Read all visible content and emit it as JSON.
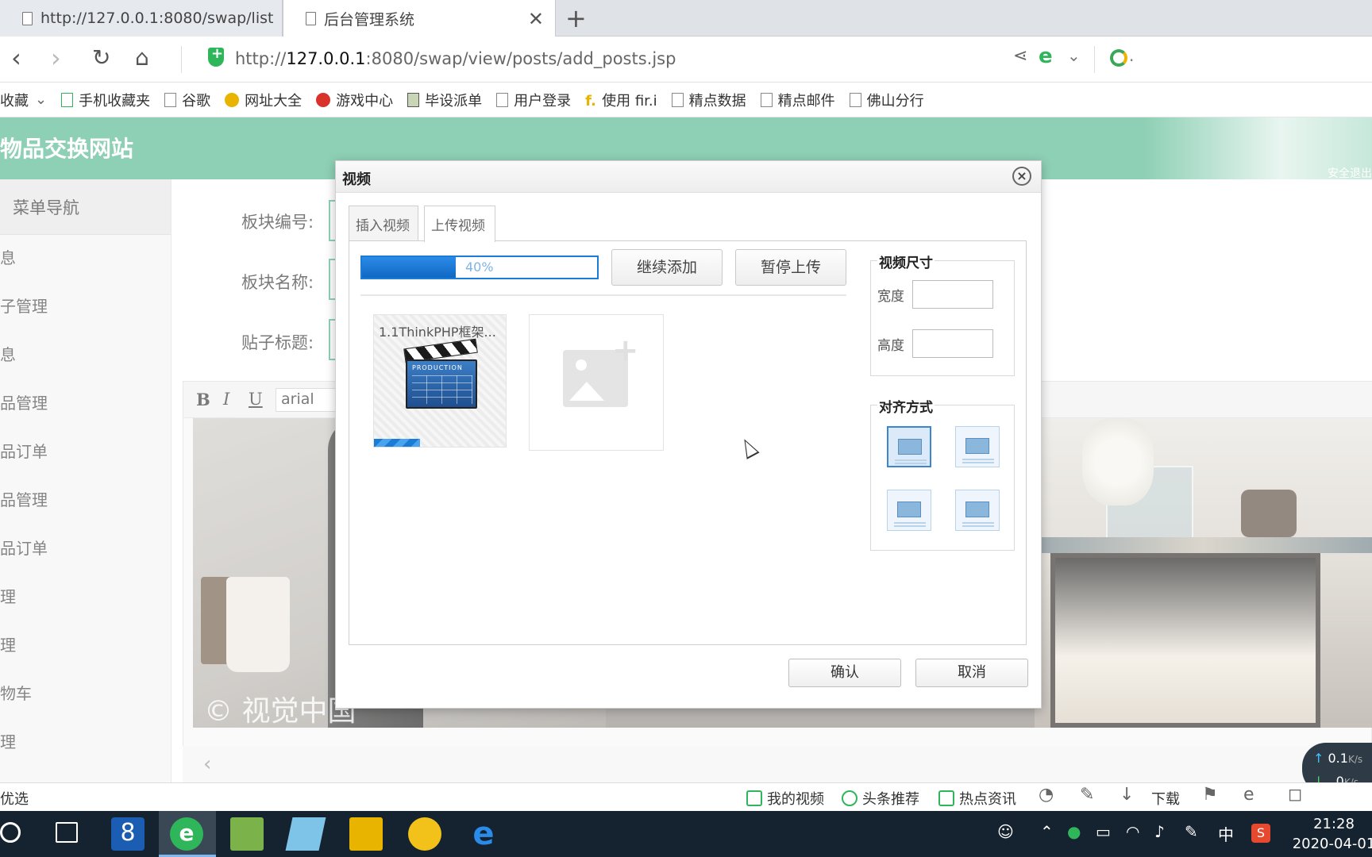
{
  "browser": {
    "tabs": [
      {
        "label": "http://127.0.0.1:8080/swap/list"
      },
      {
        "label": "后台管理系统"
      }
    ],
    "url_prefix": "http://",
    "url_host": "127.0.0.1",
    "url_rest": ":8080/swap/view/posts/add_posts.jsp",
    "bookmarks": [
      {
        "label": "收藏"
      },
      {
        "label": "手机收藏夹"
      },
      {
        "label": "谷歌"
      },
      {
        "label": "网址大全"
      },
      {
        "label": "游戏中心"
      },
      {
        "label": "毕设派单"
      },
      {
        "label": "用户登录"
      },
      {
        "label": "使用 fir.i"
      },
      {
        "label": "精点数据"
      },
      {
        "label": "精点邮件"
      },
      {
        "label": "佛山分行"
      }
    ]
  },
  "app": {
    "title": "物品交换网站",
    "header_link": "安全退出",
    "sidebar": {
      "heading": "菜单导航",
      "items": [
        "息",
        "子管理",
        "息",
        "品管理",
        "品订单",
        "品管理",
        "品订单",
        "理",
        "理",
        "物车",
        "理"
      ]
    },
    "form": {
      "board_no_label": "板块编号:",
      "board_name_label": "板块名称:",
      "post_title_label": "贴子标题:"
    },
    "editor": {
      "bold": "B",
      "italic": "I",
      "underline": "U",
      "font": "arial",
      "watermark": "© 视觉中国"
    }
  },
  "dialog": {
    "title": "视频",
    "tabs": [
      {
        "label": "插入视频",
        "active": false
      },
      {
        "label": "上传视频",
        "active": true
      }
    ],
    "progress_percent": 40,
    "progress_text": "40%",
    "continue_add_label": "继续添加",
    "pause_upload_label": "暂停上传",
    "file": {
      "name": "1.1ThinkPHP框架...",
      "upload_fraction": 0.35
    },
    "size": {
      "legend": "视频尺寸",
      "width_label": "宽度",
      "height_label": "高度",
      "width_value": "",
      "height_value": ""
    },
    "align": {
      "legend": "对齐方式",
      "selected_index": 0
    },
    "confirm_label": "确认",
    "cancel_label": "取消"
  },
  "statusbar": {
    "left": "优选",
    "items": [
      "我的视频",
      "头条推荐",
      "热点资讯",
      "下载"
    ]
  },
  "netspeed": {
    "up": "0.1",
    "down": "0",
    "unit": "K/s"
  },
  "taskbar": {
    "ime": "中",
    "time": "21:28",
    "date": "2020-04-01"
  },
  "colors": {
    "brand_green": "#52b78e",
    "progress_blue": "#1a7cd6",
    "taskbar": "#15222f"
  }
}
